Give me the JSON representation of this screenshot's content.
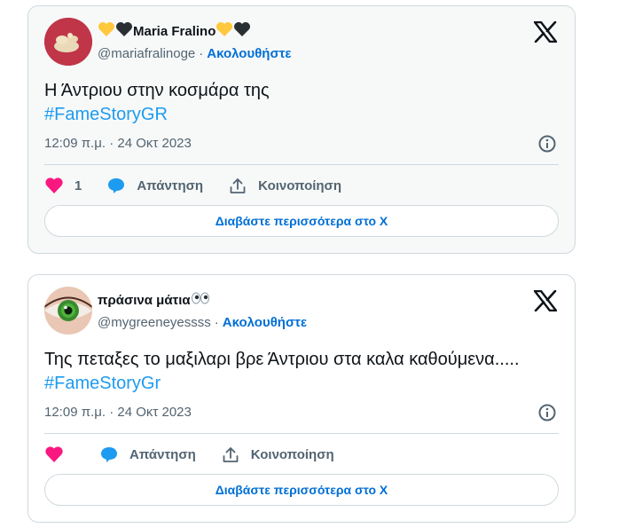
{
  "tweets": [
    {
      "display_name": "Maria Fralino",
      "name_prefix_icons": [
        "yellow-heart-icon",
        "black-heart-icon"
      ],
      "name_suffix_icons": [
        "yellow-heart-icon",
        "black-heart-icon"
      ],
      "handle": "@mariafralinoge",
      "separator": "·",
      "follow_label": "Ακολουθήστε",
      "text": "Η Άντριου στην κοσμάρα της",
      "hashtag": "#FameStoryGR",
      "timestamp": "12:09 π.μ. · 24 Οκτ 2023",
      "like_count": "1",
      "reply_label": "Απάντηση",
      "share_label": "Κοινοποίηση",
      "read_more_label": "Διαβάστε περισσότερα στο X"
    },
    {
      "display_name": "πράσινα μάτια",
      "name_suffix_icons": [
        "eyes-icon"
      ],
      "handle": "@mygreeneyessss",
      "separator": "·",
      "follow_label": "Ακολουθήστε",
      "text": "Της πεταξες το μαξιλαρι βρε Άντριου στα καλα καθούμενα.....",
      "hashtag": "#FameStoryGr",
      "timestamp": "12:09 π.μ. · 24 Οκτ 2023",
      "like_count": "",
      "reply_label": "Απάντηση",
      "share_label": "Κοινοποίηση",
      "read_more_label": "Διαβάστε περισσότερα στο X"
    }
  ],
  "colors": {
    "link": "#006fd6",
    "hashtag": "#1d9bf0",
    "like": "#f91880",
    "reply": "#1d9bf0",
    "muted": "#536471",
    "border": "#cfd9de"
  }
}
